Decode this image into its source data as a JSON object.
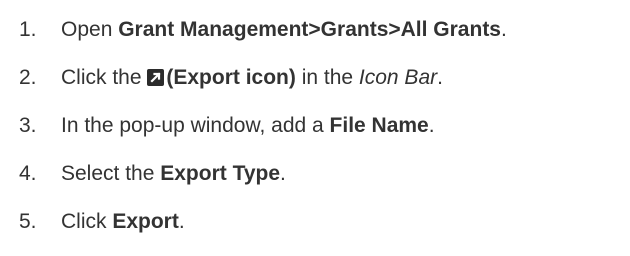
{
  "steps": [
    {
      "number": "1.",
      "parts": {
        "a": "Open ",
        "b": "Grant Management>Grants>All Grants",
        "c": "."
      }
    },
    {
      "number": "2.",
      "parts": {
        "a": "Click the ",
        "icon": "export-icon",
        "b": "(Export icon)",
        "c": " in the ",
        "d": "Icon Bar",
        "e": "."
      }
    },
    {
      "number": "3.",
      "parts": {
        "a": "In the pop-up window, add a ",
        "b": "File Name",
        "c": "."
      }
    },
    {
      "number": "4.",
      "parts": {
        "a": "Select the ",
        "b": "Export Type",
        "c": "."
      }
    },
    {
      "number": "5.",
      "parts": {
        "a": "Click ",
        "b": "Export",
        "c": "."
      }
    }
  ]
}
